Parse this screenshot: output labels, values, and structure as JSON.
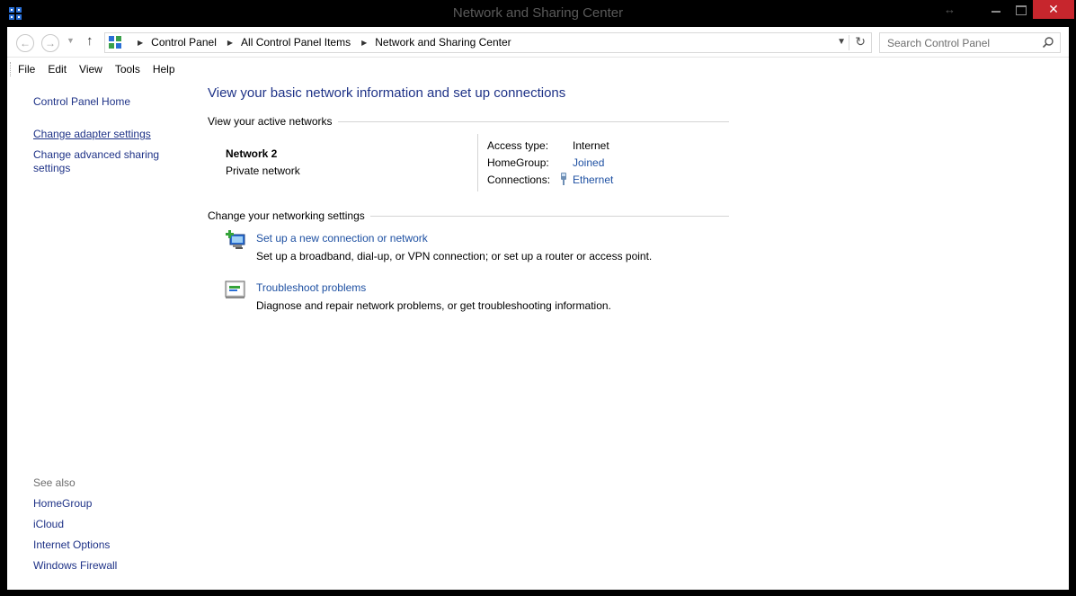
{
  "window": {
    "title": "Network and Sharing Center",
    "close_glyph": "✕",
    "resize_glyph": "↔"
  },
  "address": {
    "crumbs": [
      "Control Panel",
      "All Control Panel Items",
      "Network and Sharing Center"
    ],
    "search_placeholder": "Search Control Panel"
  },
  "menu": [
    "File",
    "Edit",
    "View",
    "Tools",
    "Help"
  ],
  "left": {
    "home": "Control Panel Home",
    "adapter": "Change adapter settings",
    "advanced": "Change advanced sharing settings",
    "see_also_label": "See also",
    "see_also": [
      "HomeGroup",
      "iCloud",
      "Internet Options",
      "Windows Firewall"
    ]
  },
  "main": {
    "title": "View your basic network information and set up connections",
    "active_heading": "View your active networks",
    "network_name": "Network  2",
    "network_type": "Private network",
    "access_label": "Access type:",
    "access_value": "Internet",
    "homegroup_label": "HomeGroup:",
    "homegroup_value": "Joined",
    "connections_label": "Connections:",
    "connections_value": "Ethernet",
    "settings_heading": "Change your networking settings",
    "tasks": [
      {
        "link": "Set up a new connection or network",
        "desc": "Set up a broadband, dial-up, or VPN connection; or set up a router or access point."
      },
      {
        "link": "Troubleshoot problems",
        "desc": "Diagnose and repair network problems, or get troubleshooting information."
      }
    ]
  },
  "icons": {
    "app": "network-control-panel-icon",
    "search": "magnifier-icon",
    "ethernet": "ethernet-plug-icon",
    "new_connection": "new-connection-icon",
    "troubleshoot": "troubleshoot-icon"
  },
  "colors": {
    "link": "#1e50a2",
    "heading": "#1e3287",
    "close_button": "#c7262d"
  }
}
